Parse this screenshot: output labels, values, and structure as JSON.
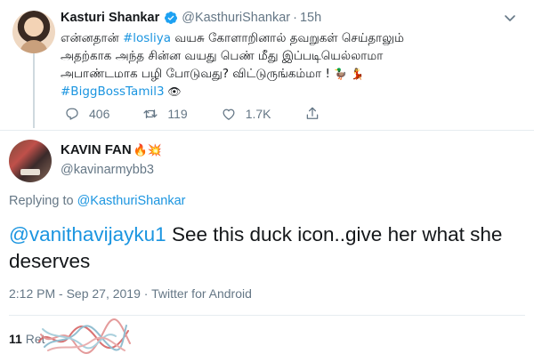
{
  "parent_tweet": {
    "author_name": "Kasturi Shankar",
    "handle": "@KasthuriShankar",
    "separator": "·",
    "time": "15h",
    "text_line1_pre": "என்னதான் ",
    "text_line1_hashtag": "#losliya",
    "text_line1_post": " வயசு கோளாறினால் தவறுகள் செய்தாலும்",
    "text_line2": "அதற்காக அந்த சின்ன வயது பெண் மீது இப்படியெல்லாமா",
    "text_line3": "அபாண்டமாக பழி போடுவது?  விட்டுருங்கம்மா ! ",
    "text_line3_emoji": "🦆 💃",
    "text_line4_hashtag": "#BiggBossTamil3",
    "text_line4_emoji": " 👁",
    "reply_count": "406",
    "retweet_count": "119",
    "like_count": "1.7K",
    "icons": [
      "verified-badge-icon",
      "chevron-down-icon",
      "reply-icon",
      "retweet-icon",
      "like-icon",
      "share-icon"
    ]
  },
  "reply_tweet": {
    "author_name": "KAVIN FAN",
    "author_emoji": "🔥💥",
    "handle": "@kavinarmybb3",
    "replying_prefix": "Replying to ",
    "replying_handle": "@KasthuriShankar",
    "mention": "@vanithavijayku1",
    "text": " See this duck icon..give her what she deserves",
    "timestamp": "2:12 PM - Sep 27, 2019 · Twitter for Android",
    "retweets_count": "11",
    "retweets_label": " Ret"
  },
  "colors": {
    "link": "#1b95e0",
    "secondary_text": "#657786",
    "primary_text": "#14171a",
    "divider": "#e6ecf0",
    "verified": "#1da1f2",
    "thread_line": "#cfd9de"
  }
}
